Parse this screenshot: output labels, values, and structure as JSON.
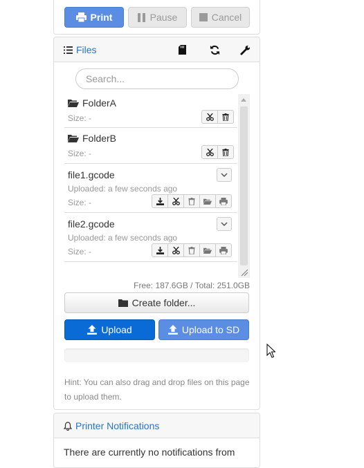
{
  "controls": {
    "print_label": "Print",
    "pause_label": "Pause",
    "cancel_label": "Cancel"
  },
  "files": {
    "title": "Files",
    "header_icons": [
      "sd-card-icon",
      "refresh-icon",
      "wrench-icon"
    ],
    "search_placeholder": "Search...",
    "folders": [
      {
        "name": "FolderA",
        "size": "Size: -"
      },
      {
        "name": "FolderB",
        "size": "Size: -"
      }
    ],
    "gcodes": [
      {
        "name": "file1.gcode",
        "uploaded": "Uploaded: a few seconds ago",
        "size": "Size: -"
      },
      {
        "name": "file2.gcode",
        "uploaded": "Uploaded: a few seconds ago",
        "size": "Size: -"
      }
    ],
    "storage": "Free: 187.6GB / Total: 251.0GB",
    "create_folder_label": "Create folder...",
    "upload_label": "Upload",
    "upload_sd_label": "Upload to SD",
    "hint": "Hint: You can also drag and drop files on this page to upload them."
  },
  "notifications": {
    "title": "Printer Notifications",
    "message": "There are currently no notifications from"
  },
  "colors": {
    "primary": "#5b8de2",
    "upload": "#0a6ad6",
    "link": "#2a73c3"
  }
}
